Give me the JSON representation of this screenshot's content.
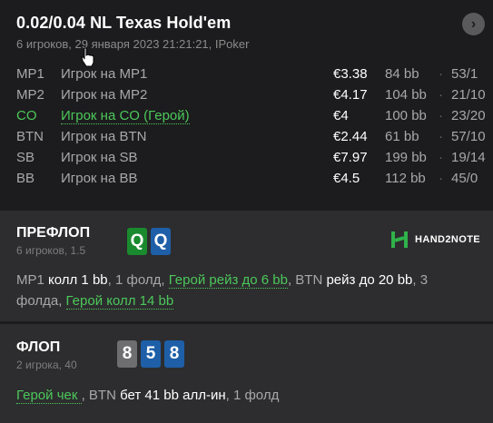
{
  "header": {
    "title": "0.02/0.04 NL Texas Hold'em",
    "subtitle": "6 игроков, 29 января 2023 21:21:21, IPoker",
    "close_glyph": "›"
  },
  "players": [
    {
      "pos": "MP1",
      "name": "Игрок на MP1",
      "stack": "€3.38",
      "bb": "84 bb",
      "dot": "·",
      "stat": "53/1",
      "hero": false
    },
    {
      "pos": "MP2",
      "name": "Игрок на MP2",
      "stack": "€4.17",
      "bb": "104 bb",
      "dot": "·",
      "stat": "21/10",
      "hero": false
    },
    {
      "pos": "CO",
      "name": "Игрок на CO (Герой)",
      "stack": "€4",
      "bb": "100 bb",
      "dot": "·",
      "stat": "23/20",
      "hero": true
    },
    {
      "pos": "BTN",
      "name": "Игрок на BTN",
      "stack": "€2.44",
      "bb": "61 bb",
      "dot": "·",
      "stat": "57/10",
      "hero": false
    },
    {
      "pos": "SB",
      "name": "Игрок на SB",
      "stack": "€7.97",
      "bb": "199 bb",
      "dot": "·",
      "stat": "19/14",
      "hero": false
    },
    {
      "pos": "BB",
      "name": "Игрок на BB",
      "stack": "€4.5",
      "bb": "112 bb",
      "dot": "·",
      "stat": "45/0",
      "hero": false
    }
  ],
  "preflop": {
    "title": "ПРЕФЛОП",
    "subtitle": "6 игроков, 1.5",
    "cards": [
      {
        "rank": "Q",
        "color": "#1a8a2e"
      },
      {
        "rank": "Q",
        "color": "#1e5fa8"
      }
    ],
    "actions": [
      {
        "text": "MP1 ",
        "style": ""
      },
      {
        "text": "колл 1 bb",
        "style": "w"
      },
      {
        "text": ", 1 фолд, ",
        "style": ""
      },
      {
        "text": "Герой рейз до 6 bb",
        "style": "g"
      },
      {
        "text": ", BTN ",
        "style": ""
      },
      {
        "text": "рейз до 20 bb",
        "style": "w"
      },
      {
        "text": ", 3 фолда, ",
        "style": ""
      },
      {
        "text": "Герой колл 14 bb",
        "style": "g"
      }
    ]
  },
  "flop": {
    "title": "ФЛОП",
    "subtitle": "2 игрока, 40",
    "cards": [
      {
        "rank": "8",
        "color": "#6e6e70"
      },
      {
        "rank": "5",
        "color": "#1e5fa8"
      },
      {
        "rank": "8",
        "color": "#1e5fa8"
      }
    ],
    "actions": [
      {
        "text": "Герой чек ",
        "style": "g"
      },
      {
        "text": ", BTN ",
        "style": ""
      },
      {
        "text": "бет 41 bb алл-ин",
        "style": "w"
      },
      {
        "text": ", 1 фолд",
        "style": ""
      }
    ]
  },
  "logo": {
    "text": "HAND2NOTE",
    "icon": "hand2note-logo-icon",
    "color": "#2fb24a"
  }
}
